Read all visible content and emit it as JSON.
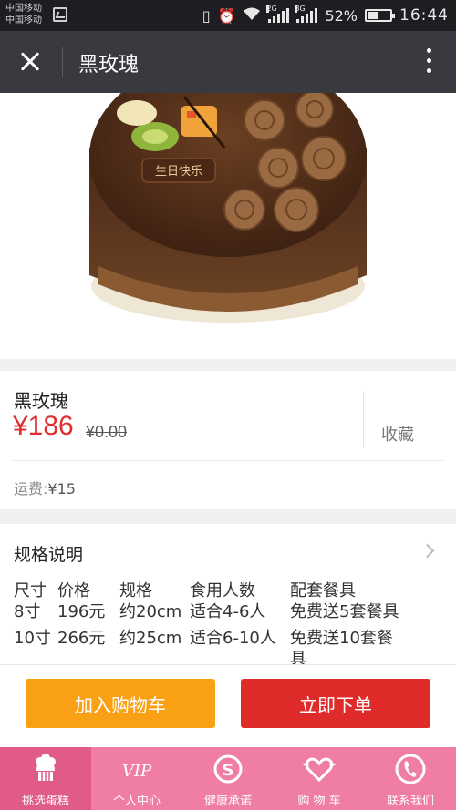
{
  "status_bar": {
    "carrier_1": "中国移动",
    "carrier_2": "中国移动",
    "battery_percent_label": "52%",
    "battery_level": 0.52,
    "time": "16:44",
    "network_1": "2G",
    "network_2": "3G"
  },
  "app_bar": {
    "title": "黑玫瑰",
    "close_icon": "close-icon",
    "more_icon": "more-vertical-icon"
  },
  "hero": {
    "cake_plaque_text": "生日快乐"
  },
  "product": {
    "name": "黑玫瑰",
    "price": "¥186",
    "original_price": "¥0.00",
    "favorite_label": "收藏",
    "shipping_label": "运费:",
    "shipping_value": "¥15"
  },
  "spec": {
    "title": "规格说明",
    "headers": [
      "尺寸",
      "价格",
      "规格",
      "食用人数",
      "配套餐具"
    ],
    "rows": [
      [
        "8寸",
        "196元",
        "约20cm",
        "适合4-6人",
        "免费送5套餐具"
      ],
      [
        "10寸",
        "266元",
        "约25cm",
        "适合6-10人",
        "免费送10套餐具"
      ]
    ]
  },
  "actions": {
    "add_to_cart": "加入购物车",
    "buy_now": "立即下单"
  },
  "tabs": [
    {
      "label": "挑选蛋糕",
      "icon": "cake-icon",
      "active": true
    },
    {
      "label": "个人中心",
      "icon": "vip-icon",
      "active": false
    },
    {
      "label": "健康承诺",
      "icon": "s-badge-icon",
      "active": false
    },
    {
      "label": "购 物 车",
      "icon": "heart-cart-icon",
      "active": false
    },
    {
      "label": "联系我们",
      "icon": "phone-icon",
      "active": false
    }
  ],
  "colors": {
    "status_bar": "#1e1e22",
    "app_bar": "#393a3f",
    "price_red": "#e02d2d",
    "cart_orange": "#f9a015",
    "buy_red": "#e02b2b",
    "tab_pink": "#ef7da5",
    "tab_active": "#e05a8a"
  }
}
